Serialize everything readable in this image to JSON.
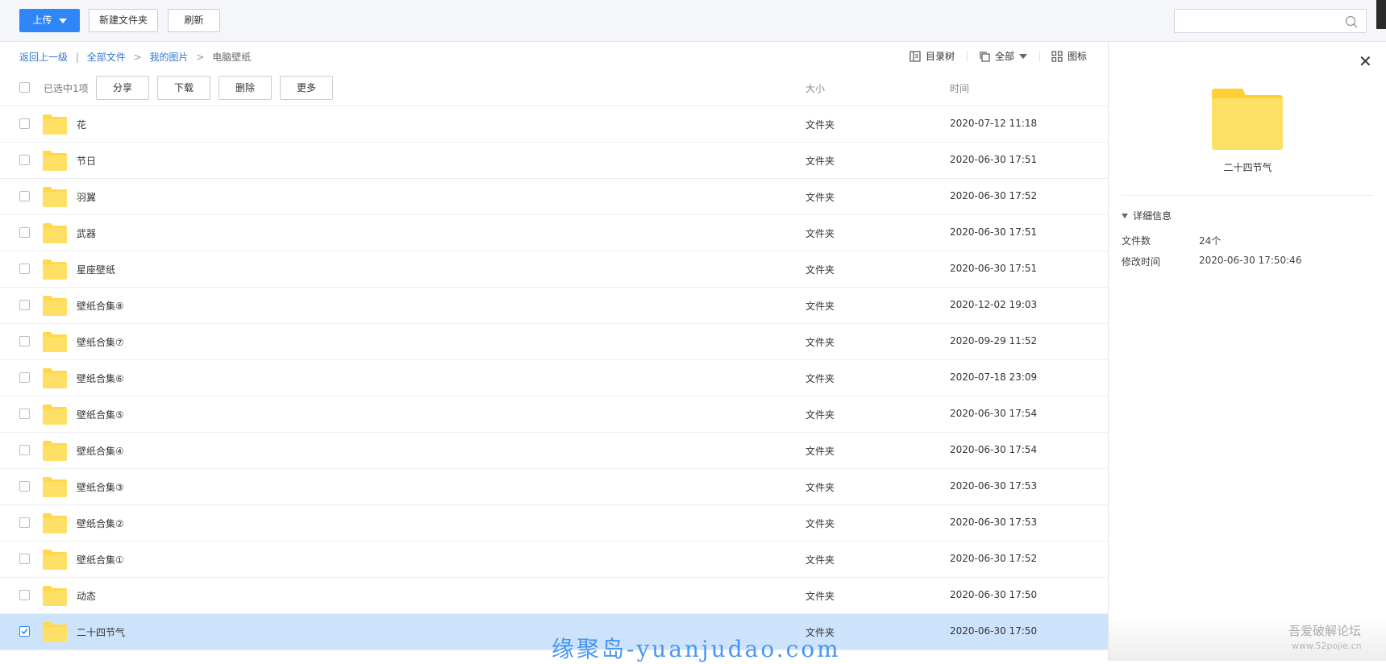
{
  "toolbar": {
    "upload_label": "上传",
    "new_folder_label": "新建文件夹",
    "refresh_label": "刷新",
    "search_placeholder": ""
  },
  "breadcrumb": {
    "back": "返回上一级",
    "divider": "|",
    "items": [
      "全部文件",
      "我的图片",
      "电脑壁纸"
    ],
    "sep": ">"
  },
  "view_tools": {
    "tree_label": "目录树",
    "filter_label": "全部",
    "icon_view_label": "图标"
  },
  "ops": {
    "selected_count": "已选中1项",
    "share": "分享",
    "download": "下载",
    "delete": "删除",
    "more": "更多"
  },
  "columns": {
    "size": "大小",
    "time": "时间"
  },
  "files": [
    {
      "name": "花",
      "size": "文件夹",
      "time": "2020-07-12 11:18",
      "checked": false
    },
    {
      "name": "节日",
      "size": "文件夹",
      "time": "2020-06-30 17:51",
      "checked": false
    },
    {
      "name": "羽翼",
      "size": "文件夹",
      "time": "2020-06-30 17:52",
      "checked": false
    },
    {
      "name": "武器",
      "size": "文件夹",
      "time": "2020-06-30 17:51",
      "checked": false
    },
    {
      "name": "星座壁纸",
      "size": "文件夹",
      "time": "2020-06-30 17:51",
      "checked": false
    },
    {
      "name": "壁纸合集⑧",
      "size": "文件夹",
      "time": "2020-12-02 19:03",
      "checked": false
    },
    {
      "name": "壁纸合集⑦",
      "size": "文件夹",
      "time": "2020-09-29 11:52",
      "checked": false
    },
    {
      "name": "壁纸合集⑥",
      "size": "文件夹",
      "time": "2020-07-18 23:09",
      "checked": false
    },
    {
      "name": "壁纸合集⑤",
      "size": "文件夹",
      "time": "2020-06-30 17:54",
      "checked": false
    },
    {
      "name": "壁纸合集④",
      "size": "文件夹",
      "time": "2020-06-30 17:54",
      "checked": false
    },
    {
      "name": "壁纸合集③",
      "size": "文件夹",
      "time": "2020-06-30 17:53",
      "checked": false
    },
    {
      "name": "壁纸合集②",
      "size": "文件夹",
      "time": "2020-06-30 17:53",
      "checked": false
    },
    {
      "name": "壁纸合集①",
      "size": "文件夹",
      "time": "2020-06-30 17:52",
      "checked": false
    },
    {
      "name": "动态",
      "size": "文件夹",
      "time": "2020-06-30 17:50",
      "checked": false
    },
    {
      "name": "二十四节气",
      "size": "文件夹",
      "time": "2020-06-30 17:50",
      "checked": true
    }
  ],
  "detail_panel": {
    "name": "二十四节气",
    "section": "详细信息",
    "fields": [
      {
        "key": "文件数",
        "value": "24个"
      },
      {
        "key": "修改时间",
        "value": "2020-06-30 17:50:46"
      }
    ]
  },
  "watermarks": {
    "main": "缘聚岛-yuanjudao.com",
    "corner": "吾爱破解论坛",
    "corner_url": "www.52pojie.cn"
  },
  "colors": {
    "primary": "#2f86f6",
    "folder": "#ffd84d",
    "selected_row": "#cde3fb",
    "link": "#2f78d0"
  }
}
